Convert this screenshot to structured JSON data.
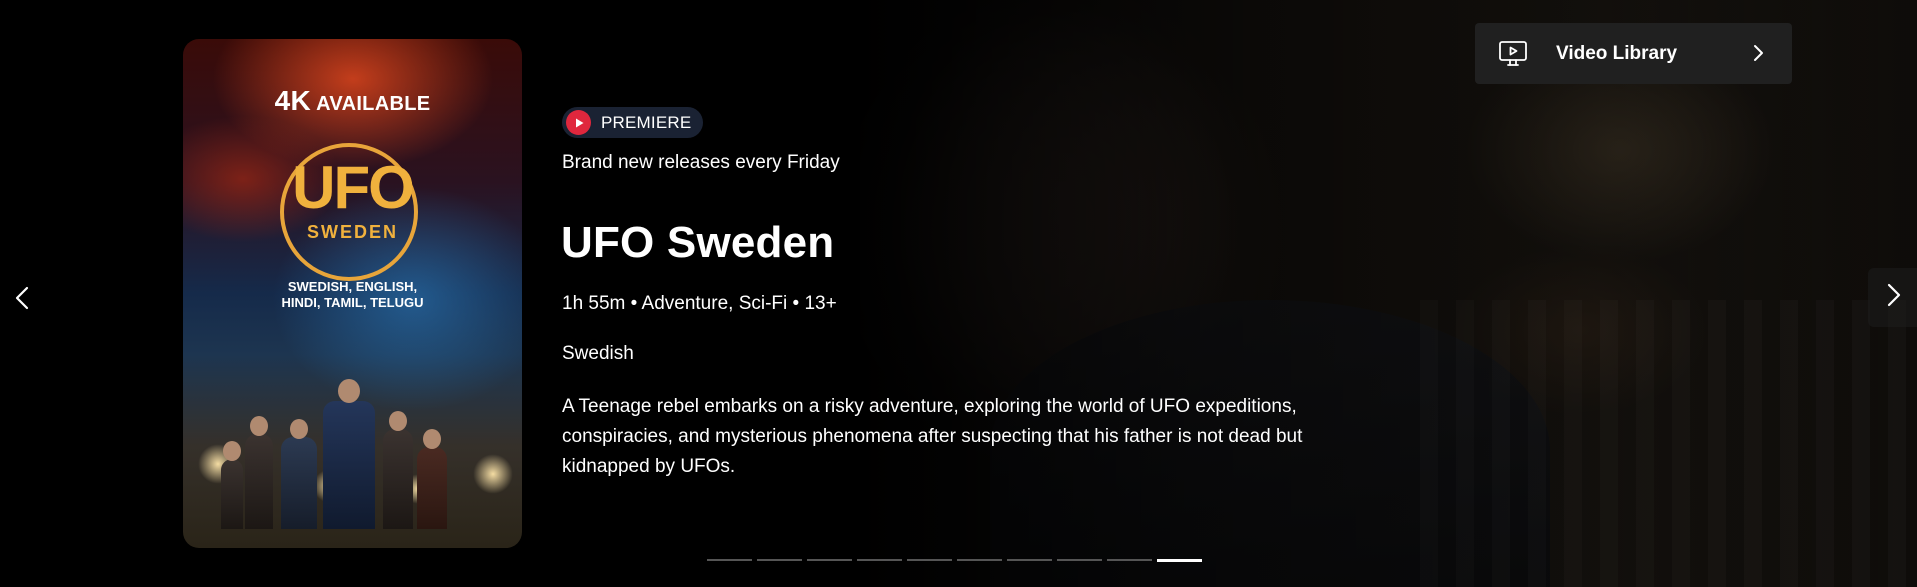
{
  "poster": {
    "badge_4k": "4K",
    "badge_available": "AVAILABLE",
    "logo_main": "UFO",
    "logo_sub": "SWEDEN",
    "languages_line1": "SWEDISH, ENGLISH,",
    "languages_line2": "HINDI, TAMIL, TELUGU"
  },
  "premiere_badge": {
    "label": "PREMIERE",
    "icon": "play-icon",
    "color": "#e0273d"
  },
  "subtitle": "Brand new releases every Friday",
  "title": "UFO Sweden",
  "meta": "1h 55m • Adventure, Sci-Fi • 13+",
  "language": "Swedish",
  "description": "A Teenage rebel embarks on a risky adventure, exploring the world of UFO expeditions, conspiracies, and mysterious phenomena after suspecting that his father is not dead but kidnapped by UFOs.",
  "video_library": {
    "label": "Video Library",
    "icon": "monitor-play-icon",
    "chevron": "chevron-right-icon"
  },
  "carousel": {
    "prev_icon": "chevron-left-icon",
    "next_icon": "chevron-right-icon",
    "slide_count": 10,
    "active_index": 9
  }
}
